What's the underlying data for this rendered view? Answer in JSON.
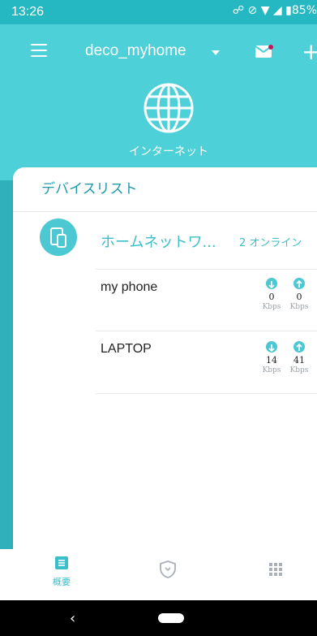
{
  "status_bar": {
    "time": "13:26",
    "battery": "85%",
    "icons": [
      "data-icon",
      "mute-icon",
      "wifi-icon",
      "signal-icon",
      "battery-icon"
    ]
  },
  "app_bar": {
    "network_name": "deco_myhome"
  },
  "internet": {
    "label": "インターネット"
  },
  "device_list": {
    "title": "デバイスリスト",
    "group": {
      "name": "ホームネットワ...",
      "online": "2 オンライン"
    },
    "devices": [
      {
        "name": "my phone",
        "download": "0",
        "upload": "0",
        "unit": "Kbps"
      },
      {
        "name": "LAPTOP",
        "download": "14",
        "upload": "41",
        "unit": "Kbps"
      }
    ]
  },
  "bottom_nav": {
    "overview_label": "概要"
  },
  "colors": {
    "accent": "#4dd0d7",
    "dark_accent": "#26b8c2",
    "notification_dot": "#c2185b"
  }
}
